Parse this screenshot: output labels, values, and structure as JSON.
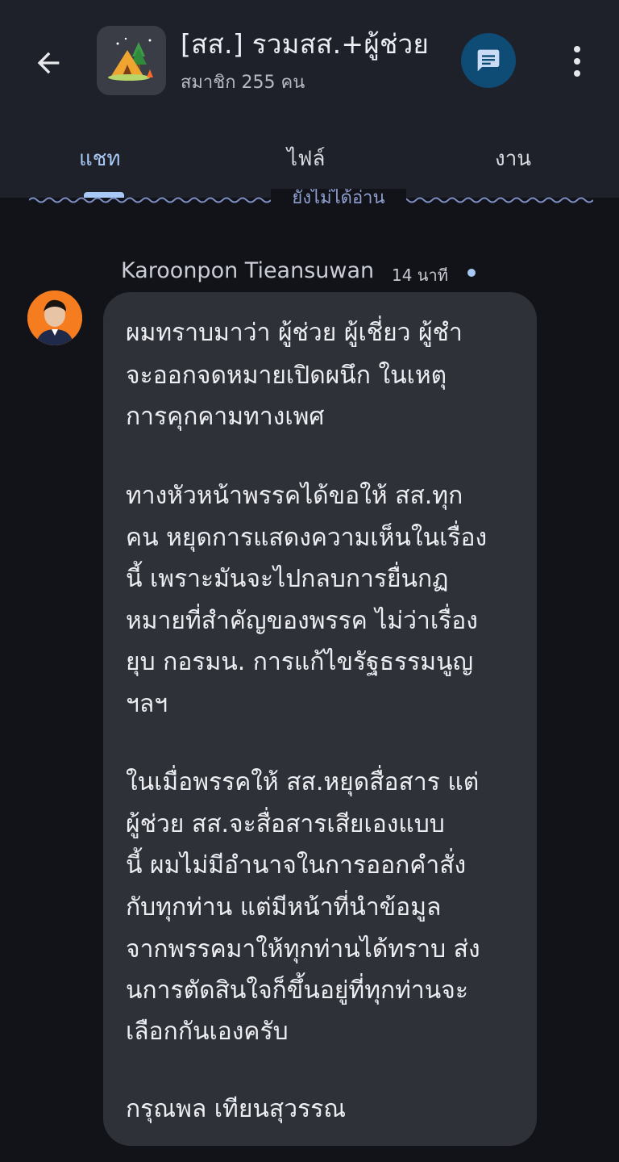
{
  "header": {
    "back_icon": "arrow-left-icon",
    "group_avatar_icon": "camping-tent-icon",
    "title": "[สส.] รวมสส.+ผู้ช่วย",
    "subtitle": "สมาชิก 255 คน",
    "chat_icon": "chat-bubble-icon",
    "more_icon": "more-vertical-icon"
  },
  "tabs": [
    {
      "label": "แชท",
      "active": true
    },
    {
      "label": "ไฟล์",
      "active": false
    },
    {
      "label": "งาน",
      "active": false
    }
  ],
  "unread_divider": {
    "label": "ยังไม่ได้อ่าน"
  },
  "message": {
    "sender": "Karoonpon Tieansuwan",
    "time": "14 นาที",
    "lines": [
      "ผมทราบมาว่า ผู้ช่วย ผู้เชี่ยว ผู้ชำ",
      "จะออกจดหมายเปิดผนึก ในเหตุ",
      "การคุกคามทางเพศ",
      "ทางหัวหน้าพรรคได้ขอให้ สส.ทุก",
      "คน หยุดการแสดงความเห็นในเรื่อง",
      "นี้ เพราะมันจะไปกลบการยื่นกฏ",
      "หมายที่สำคัญของพรรค ไม่ว่าเรื่อง",
      "ยุบ กอรมน. การแก้ไขรัฐธรรมนูญ",
      "ฯลฯ",
      "ในเมื่อพรรคให้ สส.หยุดสื่อสาร แต่",
      "ผู้ช่วย สส.จะสื่อสารเสียเองแบบ",
      "นี้ ผมไม่มีอำนาจในการออกคำสั่ง",
      "กับทุกท่าน แต่มีหน้าที่นำข้อมูล",
      "จากพรรคมาให้ทุกท่านได้ทราบ ส่ง",
      "นการตัดสินใจก็ขึ้นอยู่ที่ทุกท่านจะ",
      "เลือกกันเองครับ",
      "กรุณพล เทียนสุวรรณ"
    ]
  },
  "colors": {
    "background": "#111319",
    "header": "#1e2129",
    "bubble": "#2f3139",
    "accent": "#a8c8f5",
    "fab": "#0e4b75"
  }
}
